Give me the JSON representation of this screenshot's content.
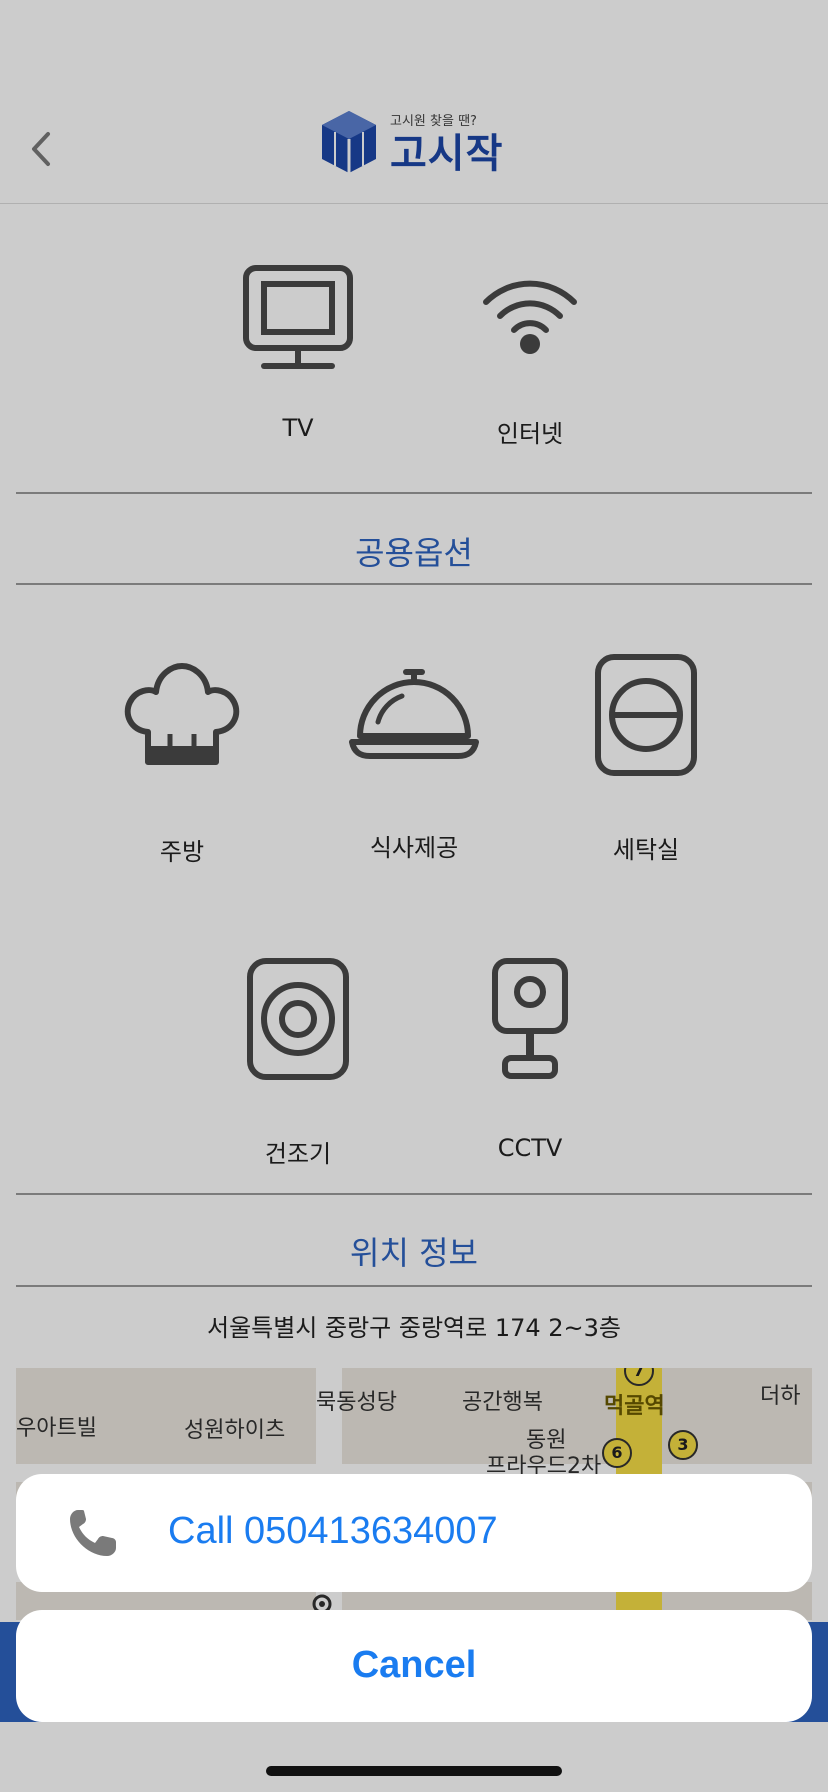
{
  "header": {
    "logo_tagline": "고시원 찾을 땐?",
    "logo_wordmark": "고시작"
  },
  "room_options": [
    {
      "label": "TV",
      "icon": "tv-icon"
    },
    {
      "label": "인터넷",
      "icon": "wifi-icon"
    }
  ],
  "shared_options": {
    "title": "공용옵션",
    "items": [
      {
        "label": "주방",
        "icon": "chef-hat-icon"
      },
      {
        "label": "식사제공",
        "icon": "cloche-icon"
      },
      {
        "label": "세탁실",
        "icon": "washing-machine-icon"
      },
      {
        "label": "건조기",
        "icon": "dryer-icon"
      },
      {
        "label": "CCTV",
        "icon": "cctv-camera-icon"
      }
    ]
  },
  "location": {
    "title": "위치 정보",
    "address": "서울특별시 중랑구 중랑역로 174 2~3층",
    "map_labels": [
      "우아트빌",
      "성원하이츠",
      "묵동성당",
      "공간행복",
      "동원",
      "프라우드2차",
      "먹골역",
      "더하"
    ],
    "map_badges": [
      "7",
      "6",
      "3"
    ]
  },
  "action_sheet": {
    "call_label": "Call 050413634007",
    "cancel_label": "Cancel"
  },
  "colors": {
    "accent_blue": "#2e63c0",
    "ios_link_blue": "#1a7cf0",
    "icon_gray": "#4a4a4a",
    "overlay": "rgba(0,0,0,0.2)"
  }
}
